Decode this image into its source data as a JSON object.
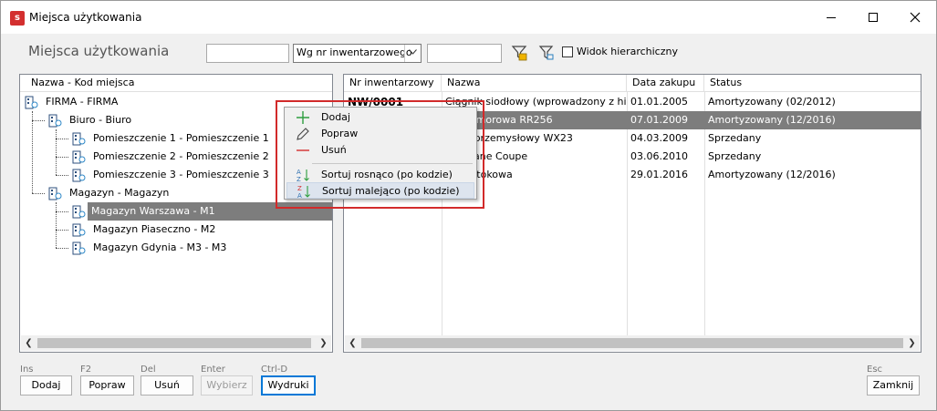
{
  "window": {
    "title": "Miejsca użytkowania",
    "app_icon_letter": "s"
  },
  "header": {
    "title": "Miejsca użytkowania",
    "sort_combo_value": "Wg nr inwentarzowego",
    "hierarchical_label": "Widok hierarchiczny",
    "hierarchical_checked": false
  },
  "tree": {
    "column_header": "Nazwa - Kod miejsca",
    "items": [
      {
        "label": "FIRMA - FIRMA"
      },
      {
        "label": "Biuro - Biuro"
      },
      {
        "label": "Pomieszczenie 1 - Pomieszczenie 1"
      },
      {
        "label": "Pomieszczenie 2 - Pomieszczenie 2"
      },
      {
        "label": "Pomieszczenie 3 - Pomieszczenie 3"
      },
      {
        "label": "Magazyn - Magazyn"
      },
      {
        "label": "Magazyn Warszawa - M1",
        "selected": true
      },
      {
        "label": "Magazyn Piaseczno - M2"
      },
      {
        "label": "Magazyn Gdynia - M3 - M3"
      }
    ]
  },
  "grid": {
    "columns": [
      "Nr inwentarzowy",
      "Nazwa",
      "Data zakupu",
      "Status"
    ],
    "rows": [
      {
        "nr": "NW/0001",
        "nazwa": "Ciągnik siodłowy (wprowadzony z historią)",
        "data": "01.01.2005",
        "status": "Amortyzowany (02/2012)"
      },
      {
        "nr": "",
        "nazwa": "nia Komorowa RR256",
        "data": "07.01.2009",
        "status": "Amortyzowany (12/2016)",
        "selected": true
      },
      {
        "nr": "",
        "nazwa": "zator przemysłowy WX23",
        "data": "04.03.2009",
        "status": "Sprzedany"
      },
      {
        "nr": "",
        "nazwa": "t Megane Coupe",
        "data": "03.06.2010",
        "status": "Sprzedany"
      },
      {
        "nr": "",
        "nazwa": "a przetokowa",
        "data": "29.01.2016",
        "status": "Amortyzowany (12/2016)"
      }
    ]
  },
  "context_menu": {
    "items": [
      {
        "label": "Dodaj",
        "icon": "plus-icon",
        "color": "#2e9e3f"
      },
      {
        "label": "Popraw",
        "icon": "pencil-icon"
      },
      {
        "label": "Usuń",
        "icon": "minus-icon",
        "color": "#d32f2f"
      },
      {
        "label": "Sortuj rosnąco (po kodzie)",
        "icon": "sort-ascending-icon"
      },
      {
        "label": "Sortuj malejąco (po kodzie)",
        "icon": "sort-descending-icon"
      }
    ]
  },
  "footer": {
    "buttons": [
      {
        "shortcut": "Ins",
        "label": "Dodaj"
      },
      {
        "shortcut": "F2",
        "label": "Popraw"
      },
      {
        "shortcut": "Del",
        "label": "Usuń"
      },
      {
        "shortcut": "Enter",
        "label": "Wybierz",
        "disabled": true
      },
      {
        "shortcut": "Ctrl-D",
        "label": "Wydruki",
        "focused": true
      }
    ],
    "close": {
      "shortcut": "Esc",
      "label": "Zamknij"
    }
  },
  "colors": {
    "selection": "#7d7d7d",
    "highlight_frame": "#d22a2a",
    "accent": "#0078d7"
  }
}
